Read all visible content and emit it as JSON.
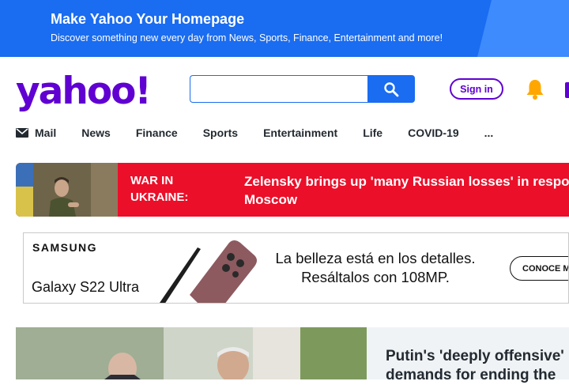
{
  "promo": {
    "title": "Make Yahoo Your Homepage",
    "subtitle": "Discover something new every day from News, Sports, Finance, Entertainment and more!",
    "bg_color": "#1a6cf0"
  },
  "header": {
    "logo": "yahoo!",
    "search_placeholder": "",
    "signin_label": "Sign in",
    "brand_color": "#6001d2"
  },
  "nav": {
    "items": [
      "Mail",
      "News",
      "Finance",
      "Sports",
      "Entertainment",
      "Life",
      "COVID-19",
      "..."
    ]
  },
  "breaking": {
    "label": "WAR IN UKRAINE:",
    "headline_line1": "Zelensky brings up 'many Russian losses' in respo",
    "headline_line2": "Moscow",
    "bg_color": "#eb0f29"
  },
  "ad": {
    "brand": "SAMSUNG",
    "product": "Galaxy S22 Ultra",
    "tagline_line1": "La belleza está en los detalles.",
    "tagline_line2": "Resáltalos con 108MP.",
    "cta": "CONOCE MÁ"
  },
  "top_story": {
    "headline_line1": "Putin's 'deeply offensive'",
    "headline_line2": "demands for ending the"
  },
  "icons": [
    "search-icon",
    "bell-icon",
    "mail-icon"
  ]
}
